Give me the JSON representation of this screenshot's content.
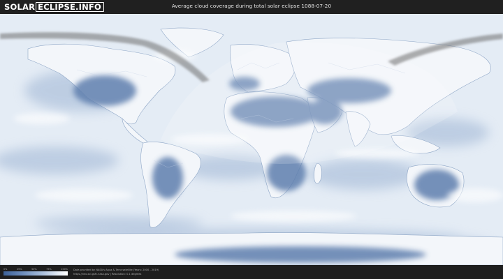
{
  "header": {
    "logo_part1": "SOLAR",
    "logo_part2": "ECLIPSE.INFO",
    "title": "Average cloud coverage during total solar eclipse 1088-07-20"
  },
  "legend": {
    "ticks": [
      "0%",
      "25%",
      "50%",
      "75%",
      "100%"
    ],
    "colors": [
      "#3d6299",
      "#6e8ebc",
      "#a8bedb",
      "#e3ebf5",
      "#ffffff"
    ]
  },
  "credits": {
    "line1": "Data provided by NASA's Aqua & Terra satellite (Years: 2000 - 2019)",
    "line2": "https://neo.sci.gsfc.nasa.gov | Resolution: 0.1 degrees"
  },
  "map": {
    "ocean_color": "#e4ecf5",
    "land_cloudy_color": "#f3f6fa",
    "clear_sky_color": "#5e7fae",
    "eclipse_path_color": "#6f6f6f"
  }
}
